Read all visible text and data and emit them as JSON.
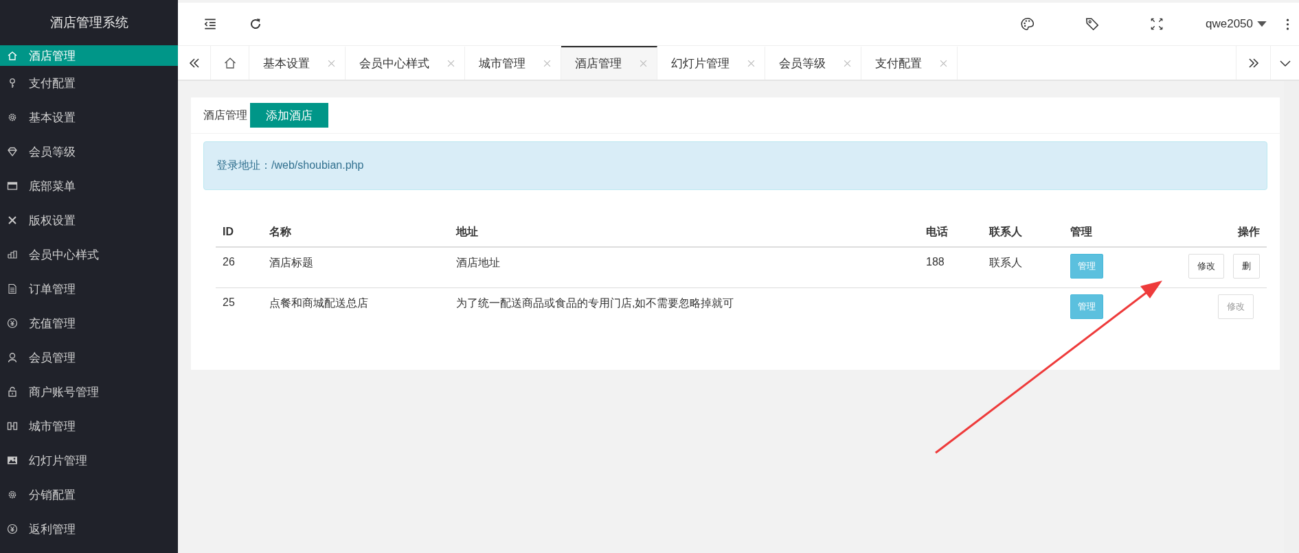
{
  "sidebar": {
    "title": "酒店管理系统",
    "items": [
      {
        "label": "酒店管理",
        "selected": true
      },
      {
        "label": "支付配置",
        "selected": false
      },
      {
        "label": "基本设置",
        "selected": false
      },
      {
        "label": "会员等级",
        "selected": false
      },
      {
        "label": "底部菜单",
        "selected": false
      },
      {
        "label": "版权设置",
        "selected": false
      },
      {
        "label": "会员中心样式",
        "selected": false
      },
      {
        "label": "订单管理",
        "selected": false
      },
      {
        "label": "充值管理",
        "selected": false
      },
      {
        "label": "会员管理",
        "selected": false
      },
      {
        "label": "商户账号管理",
        "selected": false
      },
      {
        "label": "城市管理",
        "selected": false
      },
      {
        "label": "幻灯片管理",
        "selected": false
      },
      {
        "label": "分销配置",
        "selected": false
      },
      {
        "label": "返利管理",
        "selected": false
      }
    ]
  },
  "header": {
    "user": "qwe2050"
  },
  "tabs": [
    {
      "label": "基本设置",
      "selected": false
    },
    {
      "label": "会员中心样式",
      "selected": false
    },
    {
      "label": "城市管理",
      "selected": false
    },
    {
      "label": "酒店管理",
      "selected": true
    },
    {
      "label": "幻灯片管理",
      "selected": false
    },
    {
      "label": "会员等级",
      "selected": false
    },
    {
      "label": "支付配置",
      "selected": false
    }
  ],
  "page": {
    "title": "酒店管理",
    "add_button": "添加酒店",
    "notice": "登录地址：/web/shoubian.php"
  },
  "table": {
    "columns": [
      "ID",
      "名称",
      "地址",
      "电话",
      "联系人",
      "管理",
      "操作"
    ],
    "rows": [
      {
        "id": "26",
        "name": "酒店标题",
        "address": "酒店地址",
        "phone": "188",
        "contact": "联系人",
        "manage": "管理",
        "actions": [
          {
            "label": "修改",
            "disabled": false
          },
          {
            "label": "删",
            "disabled": false
          }
        ]
      },
      {
        "id": "25",
        "name": "点餐和商城配送总店",
        "address": "为了统一配送商品或食品的专用门店,如不需要忽略掉就可",
        "manage": "管理",
        "actions": [
          {
            "label": "修改",
            "disabled": true
          }
        ]
      }
    ]
  }
}
